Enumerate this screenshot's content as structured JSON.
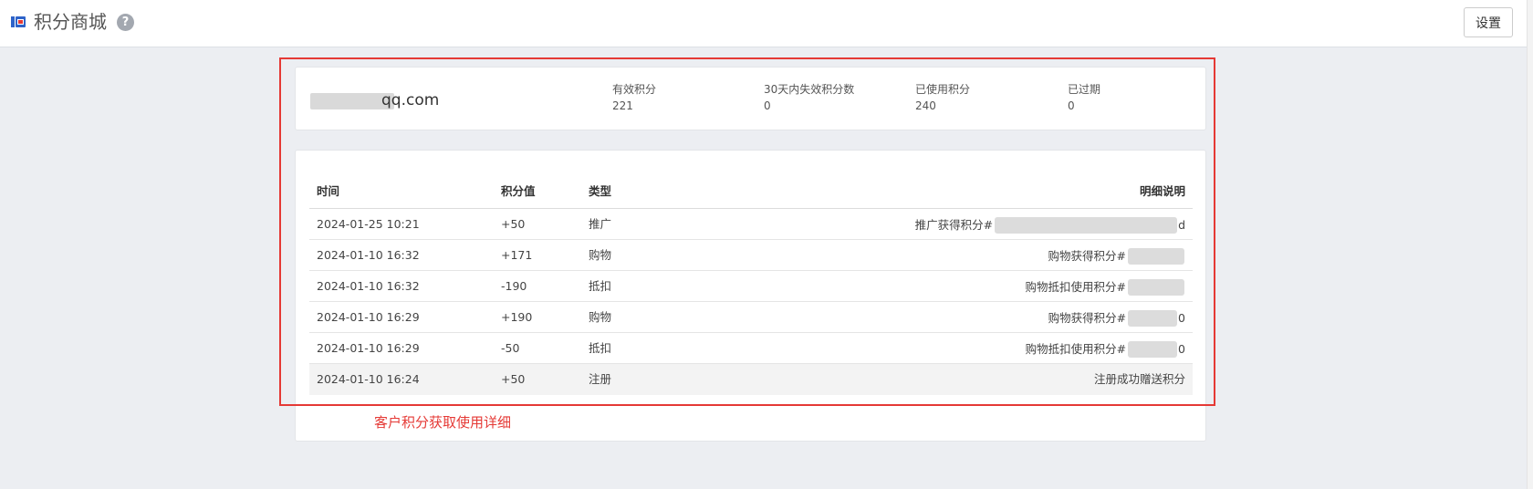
{
  "header": {
    "title": "积分商城",
    "help_icon": "?",
    "settings_label": "设置",
    "logo_icon": "app-logo-icon"
  },
  "summary": {
    "account_visible": "qq.com",
    "stats": [
      {
        "label": "有效积分",
        "value": "221"
      },
      {
        "label": "30天内失效积分数",
        "value": "0"
      },
      {
        "label": "已使用积分",
        "value": "240"
      },
      {
        "label": "已过期",
        "value": "0"
      }
    ]
  },
  "points_table": {
    "columns": [
      "时间",
      "积分值",
      "类型",
      "明细说明"
    ],
    "rows": [
      {
        "time": "2024-01-25 10:21",
        "value": "+50",
        "type": "推广",
        "desc": "推广获得积分#",
        "desc_tail": "d"
      },
      {
        "time": "2024-01-10 16:32",
        "value": "+171",
        "type": "购物",
        "desc": "购物获得积分#",
        "desc_tail": ""
      },
      {
        "time": "2024-01-10 16:32",
        "value": "-190",
        "type": "抵扣",
        "desc": "购物抵扣使用积分#",
        "desc_tail": ""
      },
      {
        "time": "2024-01-10 16:29",
        "value": "+190",
        "type": "购物",
        "desc": "购物获得积分#",
        "desc_tail": "0"
      },
      {
        "time": "2024-01-10 16:29",
        "value": "-50",
        "type": "抵扣",
        "desc": "购物抵扣使用积分#",
        "desc_tail": "0"
      },
      {
        "time": "2024-01-10 16:24",
        "value": "+50",
        "type": "注册",
        "desc": "注册成功赠送积分",
        "desc_tail": ""
      }
    ]
  },
  "annotation": {
    "text": "客户积分获取使用详细",
    "color": "#e53935"
  }
}
